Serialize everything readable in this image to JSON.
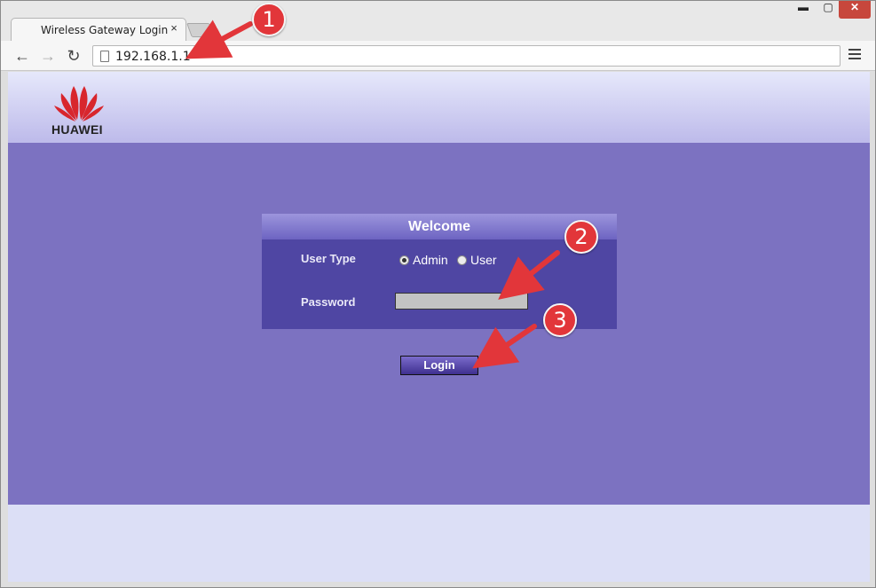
{
  "browser": {
    "tab_title": "Wireless Gateway Login",
    "tab_close": "×",
    "url": "192.168.1.1",
    "window_controls": {
      "minimize": "▬",
      "maximize": "▢",
      "close": "✕"
    },
    "nav": {
      "back": "←",
      "forward": "→",
      "reload": "↻"
    }
  },
  "header": {
    "logo_text": "HUAWEI"
  },
  "login": {
    "title": "Welcome",
    "user_type_label": "User Type",
    "options": [
      "Admin",
      "User"
    ],
    "selected_option": "Admin",
    "password_label": "Password",
    "password_value": "",
    "button_label": "Login"
  },
  "annotations": [
    "1",
    "2",
    "3"
  ],
  "colors": {
    "page_background": "#7c72c1",
    "panel": "#4f46a3",
    "header_gradient_top": "#e6e8fb",
    "annotation_red": "#e2363a",
    "logo_red": "#d8262d"
  }
}
